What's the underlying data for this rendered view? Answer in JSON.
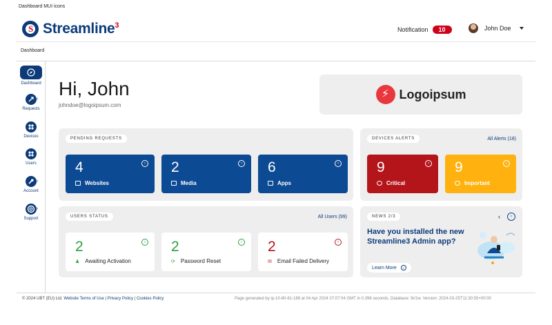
{
  "doc_title": "Dashboard MUI icons",
  "header": {
    "brand": "Streamline",
    "brand_sup": "3",
    "notification_label": "Notification",
    "notification_count": "10",
    "user_name": "John Doe"
  },
  "breadcrumb": "Dashboard",
  "sidebar": {
    "items": [
      {
        "label": "Dashboard",
        "icon": "compass-icon",
        "active": true
      },
      {
        "label": "Requests",
        "icon": "requests-icon"
      },
      {
        "label": "Devices",
        "icon": "devices-icon"
      },
      {
        "label": "Users",
        "icon": "users-icon"
      },
      {
        "label": "Account",
        "icon": "wrench-icon"
      },
      {
        "label": "Support",
        "icon": "lifebuoy-icon"
      }
    ]
  },
  "greeting": {
    "hello": "Hi, John",
    "email": "johndoe@logoipsum.com"
  },
  "brand_card": {
    "text": "Logoipsum"
  },
  "pending": {
    "title": "PENDING REQUESTS",
    "tiles": [
      {
        "value": "4",
        "label": "Websites"
      },
      {
        "value": "2",
        "label": "Media"
      },
      {
        "value": "6",
        "label": "Apps"
      }
    ]
  },
  "alerts": {
    "title": "DEVICES ALERTS",
    "link": "All Alerts (18)",
    "tiles": [
      {
        "value": "9",
        "label": "Critical"
      },
      {
        "value": "9",
        "label": "Important"
      }
    ]
  },
  "users": {
    "title": "USERS STATUS",
    "link": "All Users (99)",
    "stats": [
      {
        "value": "2",
        "label": "Awaiting Activation",
        "color": "#2e9e3e"
      },
      {
        "value": "2",
        "label": "Password Reset",
        "color": "#2e9e3e"
      },
      {
        "value": "2",
        "label": "Email Failed Delivery",
        "color": "#b3151b"
      }
    ]
  },
  "news": {
    "title": "NEWS 2/3",
    "headline": "Have you installed  the new Streamline3 Admin app?",
    "more": "Learn More"
  },
  "footer": {
    "copyright": "© 2024 UBT (EU) Ltd.",
    "terms": "Website Terms of Use",
    "privacy": "Privacy Policy",
    "cookies": "Cookies Policy",
    "generated": "Page generated by ip-10-80-61-188 at 04 Apr 2024 07:07:04 GMT in 0.396 seconds. Database: 9r/1w. Version: 2024-03-25T11:30:55+00:00"
  },
  "colors": {
    "primary": "#0d4a94",
    "critical": "#b3151b",
    "important": "#ffb20f",
    "success": "#2e9e3e"
  }
}
